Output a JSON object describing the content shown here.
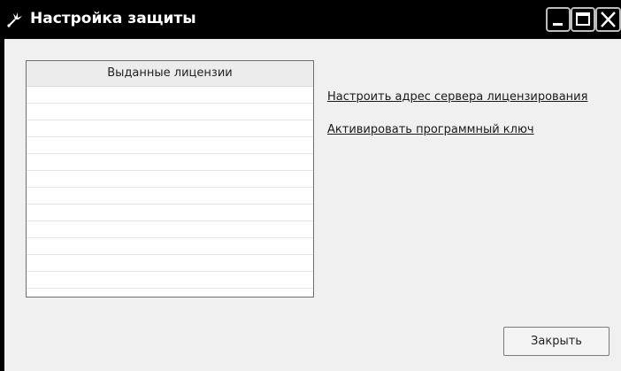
{
  "window": {
    "title": "Настройка защиты",
    "icon": "tool-icon"
  },
  "titlebar_buttons": {
    "minimize_icon": "minimize-icon",
    "maximize_icon": "maximize-icon",
    "close_icon": "close-icon"
  },
  "licenses": {
    "header": "Выданные лицензии",
    "rows": []
  },
  "links": {
    "configure_server": "Настроить адрес сервера лицензирования",
    "activate_key": "Активировать программный ключ"
  },
  "footer": {
    "close_label": "Закрыть"
  },
  "colors": {
    "titlebar": "#000000",
    "client_bg": "#f0f0f0",
    "list_bg": "#ffffff"
  }
}
